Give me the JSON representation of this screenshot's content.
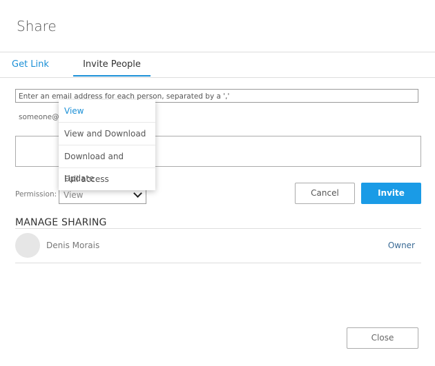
{
  "dialog": {
    "title": "Share",
    "close_label": "Close"
  },
  "tabs": [
    {
      "label": "Get Link",
      "active": false
    },
    {
      "label": "Invite People",
      "active": true
    }
  ],
  "invite": {
    "email_placeholder": "Enter an email address for each person, separated by a ','",
    "hint": "someone@s",
    "message_value": "",
    "permission_label": "Permission:",
    "permission_selected": "View",
    "permission_options": [
      "View",
      "View and Download",
      "Download and Update",
      "Full access"
    ],
    "cancel_label": "Cancel",
    "invite_label": "Invite"
  },
  "manage_sharing": {
    "heading": "MANAGE SHARING",
    "users": [
      {
        "name": "Denis Morais",
        "role": "Owner"
      }
    ]
  },
  "colors": {
    "accent": "#1a9be6",
    "link": "#1a8fd6"
  }
}
